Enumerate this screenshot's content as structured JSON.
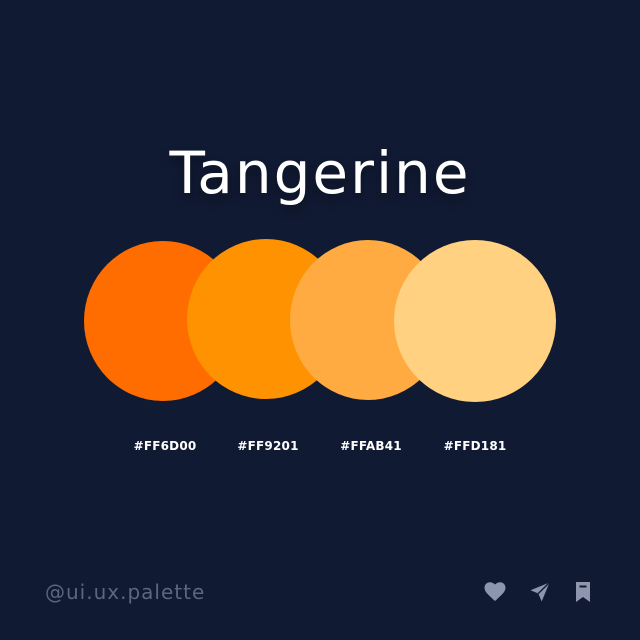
{
  "title": "Tangerine",
  "palette": [
    {
      "hex": "#FF6D00",
      "color": "#FF6D00"
    },
    {
      "hex": "#FF9201",
      "color": "#FF9201"
    },
    {
      "hex": "#FFAB41",
      "color": "#FFAB41"
    },
    {
      "hex": "#FFD181",
      "color": "#FFD181"
    }
  ],
  "handle": "@ui.ux.palette",
  "actions": {
    "like_icon": "heart-icon",
    "share_icon": "send-icon",
    "save_icon": "bookmark-icon"
  },
  "colors": {
    "background": "#111a33",
    "title": "#ffffff",
    "hex_text": "#ffffff",
    "footer": "#5d6680"
  }
}
